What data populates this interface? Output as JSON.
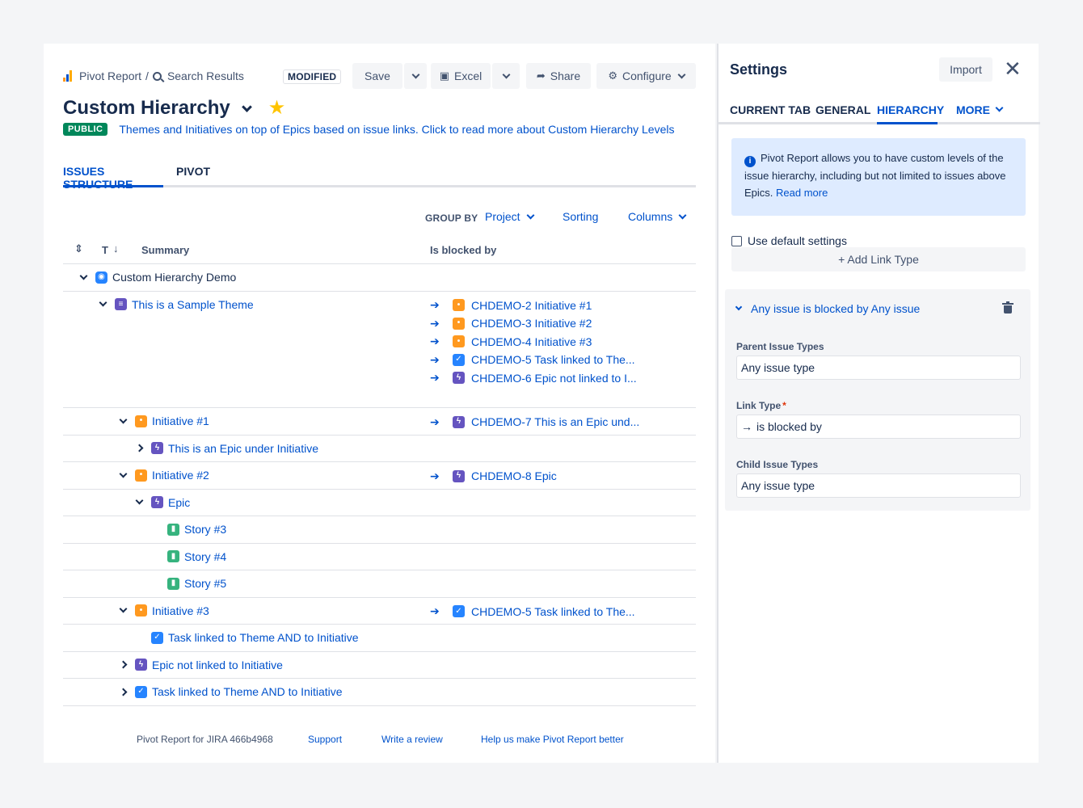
{
  "header": {
    "breadcrumb_root": "Pivot Report",
    "breadcrumb_sep": "/",
    "breadcrumb_current": "Search Results",
    "modified_label": "MODIFIED",
    "save_label": "Save",
    "excel_label": "Excel",
    "share_label": "Share",
    "configure_label": "Configure"
  },
  "report": {
    "title": "Custom Hierarchy",
    "badge": "PUBLIC",
    "description": "Themes and Initiatives on top of Epics based on issue links. Click to read more about Custom Hierarchy Levels"
  },
  "tabs": [
    "ISSUES STRUCTURE",
    "PIVOT"
  ],
  "toolbar": {
    "group_by_label": "GROUP BY",
    "group_by_value": "Project",
    "sorting_label": "Sorting",
    "columns_label": "Columns"
  },
  "table": {
    "col_type": "T",
    "col_summary": "Summary",
    "col_blocked": "Is blocked by",
    "rows": [
      {
        "indent": 0,
        "toggle": "down",
        "icon": "project",
        "text": "Custom Hierarchy Demo",
        "blocked": []
      },
      {
        "indent": 1,
        "toggle": "down",
        "icon": "theme",
        "text": "This is a Sample Theme",
        "blocked": [
          {
            "icon": "initiative",
            "text": "CHDEMO-2 Initiative #1"
          },
          {
            "icon": "initiative",
            "text": "CHDEMO-3 Initiative #2"
          },
          {
            "icon": "initiative",
            "text": "CHDEMO-4 Initiative #3"
          },
          {
            "icon": "task",
            "text": "CHDEMO-5 Task linked to The..."
          },
          {
            "icon": "epic",
            "text": "CHDEMO-6 Epic not linked to I..."
          }
        ]
      },
      {
        "indent": 2,
        "toggle": "down",
        "icon": "initiative",
        "text": "Initiative #1",
        "blocked": [
          {
            "icon": "epic",
            "text": "CHDEMO-7 This is an Epic und..."
          }
        ]
      },
      {
        "indent": 3,
        "toggle": "right",
        "icon": "epic",
        "text": "This is an Epic under Initiative",
        "blocked": []
      },
      {
        "indent": 2,
        "toggle": "down",
        "icon": "initiative",
        "text": "Initiative #2",
        "blocked": [
          {
            "icon": "epic",
            "text": "CHDEMO-8 Epic"
          }
        ]
      },
      {
        "indent": 3,
        "toggle": "down",
        "icon": "epic",
        "text": "Epic",
        "blocked": []
      },
      {
        "indent": 4,
        "toggle": "none",
        "icon": "story",
        "text": "Story #3",
        "blocked": []
      },
      {
        "indent": 4,
        "toggle": "none",
        "icon": "story",
        "text": "Story #4",
        "blocked": []
      },
      {
        "indent": 4,
        "toggle": "none",
        "icon": "story",
        "text": "Story #5",
        "blocked": []
      },
      {
        "indent": 2,
        "toggle": "down",
        "icon": "initiative",
        "text": "Initiative #3",
        "blocked": [
          {
            "icon": "task",
            "text": "CHDEMO-5 Task linked to The..."
          }
        ]
      },
      {
        "indent": 3,
        "toggle": "none",
        "icon": "task",
        "text": "Task linked to Theme AND to Initiative",
        "blocked": []
      },
      {
        "indent": 2,
        "toggle": "right",
        "icon": "epic",
        "text": "Epic not linked to Initiative",
        "blocked": []
      },
      {
        "indent": 2,
        "toggle": "right",
        "icon": "task",
        "text": "Task linked to Theme AND to Initiative",
        "blocked": []
      }
    ]
  },
  "footer": {
    "version": "Pivot Report for JIRA 466b4968",
    "support": "Support",
    "review": "Write a review",
    "feedback": "Help us make Pivot Report better"
  },
  "settings": {
    "title": "Settings",
    "import_label": "Import",
    "tabs": [
      "CURRENT TAB",
      "GENERAL",
      "HIERARCHY",
      "MORE"
    ],
    "info_text": "Pivot Report allows you to have custom levels of the issue hierarchy, including but not limited to issues above Epics.",
    "info_link": "Read more",
    "use_default_label": "Use default settings",
    "add_link_label": "+ Add Link Type",
    "rule": {
      "title": "Any issue is blocked by Any issue",
      "parent_label": "Parent Issue Types",
      "parent_value": "Any issue type",
      "link_label": "Link Type",
      "link_required": "*",
      "link_value": "is blocked by",
      "child_label": "Child Issue Types",
      "child_value": "Any issue type"
    }
  },
  "colors": {
    "accent": "#0052cc",
    "badge_green": "#00875a",
    "initiative": "#ff991f",
    "epic": "#6554c0",
    "story": "#36b37e",
    "task": "#2684ff"
  }
}
